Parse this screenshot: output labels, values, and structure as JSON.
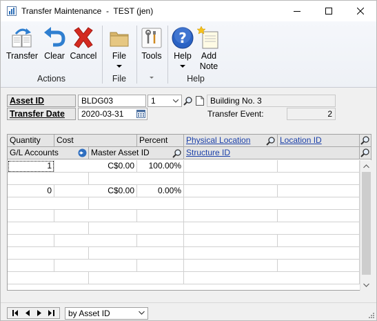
{
  "window": {
    "title": "Transfer Maintenance  -  TEST (jen)"
  },
  "ribbon": {
    "buttons": {
      "transfer": "Transfer",
      "clear": "Clear",
      "cancel": "Cancel",
      "file": "File",
      "tools": "Tools",
      "help": "Help",
      "add_note_line1": "Add",
      "add_note_line2": "Note"
    },
    "groups": {
      "actions": "Actions",
      "file": "File",
      "help": "Help"
    }
  },
  "form": {
    "asset_id_label": "Asset ID",
    "asset_id_value": "BLDG03",
    "asset_suffix": "1",
    "asset_description": "Building No. 3",
    "transfer_date_label": "Transfer Date",
    "transfer_date_value": "2020-03-31",
    "transfer_event_label": "Transfer Event:",
    "transfer_event_value": "2"
  },
  "grid": {
    "headers_row1": {
      "quantity": "Quantity",
      "cost": "Cost",
      "percent": "Percent",
      "physical_location": "Physical Location",
      "location_id": "Location ID"
    },
    "headers_row2": {
      "gl_accounts": "G/L Accounts",
      "master_asset_id": "Master Asset ID",
      "structure_id": "Structure ID"
    },
    "rows": [
      {
        "quantity": "1",
        "cost": "C$0.00",
        "percent": "100.00%"
      },
      {
        "quantity": "0",
        "cost": "C$0.00",
        "percent": "0.00%"
      }
    ]
  },
  "footer": {
    "sort_by": "by Asset ID"
  },
  "colors": {
    "link": "#1a3fa8",
    "ribbon_bg": "#eef1f6"
  }
}
